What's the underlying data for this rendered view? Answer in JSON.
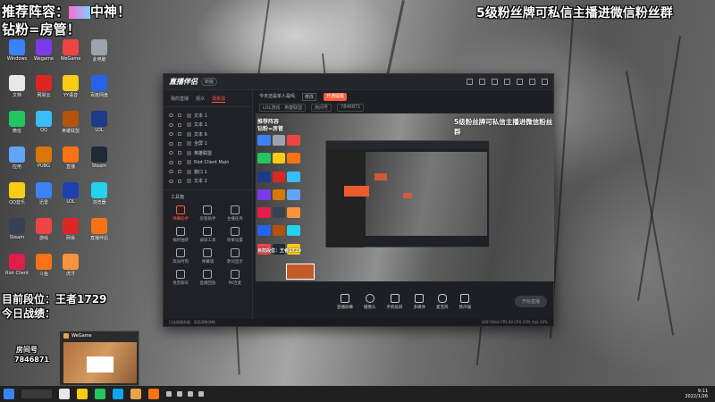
{
  "overlay": {
    "top_left_line1": "推荐阵容：",
    "top_left_line1_b": "中神！",
    "top_left_line2": "钻粉=房管！",
    "top_right": "5级粉丝牌可私信主播进微信粉丝群",
    "mid_left_line1": "目前段位：王者1729",
    "mid_left_line2": "今日战绩：",
    "room_label": "房间号",
    "room_id": "7846871"
  },
  "desktop_icons": [
    {
      "label": "Windows",
      "color": "#3b82f6"
    },
    {
      "label": "Wegame",
      "color": "#7c3aed"
    },
    {
      "label": "WeGame",
      "color": "#ef4444"
    },
    {
      "label": "此电脑",
      "color": "#9ca3af"
    },
    {
      "label": "文档",
      "color": "#e5e7eb"
    },
    {
      "label": "网易云",
      "color": "#dc2626"
    },
    {
      "label": "YY语音",
      "color": "#facc15"
    },
    {
      "label": "百度网盘",
      "color": "#2563eb"
    },
    {
      "label": "微信",
      "color": "#22c55e"
    },
    {
      "label": "QQ",
      "color": "#38bdf8"
    },
    {
      "label": "英雄联盟",
      "color": "#b45309"
    },
    {
      "label": "LOL",
      "color": "#1e3a8a"
    },
    {
      "label": "应用",
      "color": "#60a5fa"
    },
    {
      "label": "PUBG",
      "color": "#d97706"
    },
    {
      "label": "直播",
      "color": "#f97316"
    },
    {
      "label": "Steam",
      "color": "#1f2937"
    },
    {
      "label": "QQ音乐",
      "color": "#facc15"
    },
    {
      "label": "迅雷",
      "color": "#3b82f6"
    },
    {
      "label": "LOL",
      "color": "#1e40af"
    },
    {
      "label": "浏览器",
      "color": "#22d3ee"
    },
    {
      "label": "Steam",
      "color": "#374151"
    },
    {
      "label": "游戏",
      "color": "#ef4444"
    },
    {
      "label": "网易",
      "color": "#dc2626"
    },
    {
      "label": "直播伴侣",
      "color": "#f97316"
    },
    {
      "label": "Riot Client",
      "color": "#e11d48"
    },
    {
      "label": "斗鱼",
      "color": "#f97316"
    },
    {
      "label": "虎牙",
      "color": "#fb923c"
    }
  ],
  "app": {
    "logo": "直播伴侣",
    "version": "新版",
    "tabs": [
      "我的直播",
      "观众",
      "场景源"
    ],
    "sources": [
      "文本 1",
      "文本 1",
      "文本 6",
      "全屏 1",
      "英雄联盟",
      "Riot Client Main",
      "窗口 1",
      "文本 2"
    ],
    "tools_title": "工具箱",
    "tools": [
      "弹幕助手",
      "房管助手",
      "主播任务",
      "福利抽奖",
      "录屏工具",
      "效果设置",
      "高光时刻",
      "弹幕墙",
      "歌词显示",
      "语音聊天",
      "直播回放",
      "PK连麦"
    ],
    "info_title": "今天还是单人是吗",
    "info_tag": "修改",
    "info_badge": "开通提醒",
    "info_category": "LOL游戏 · 英雄联盟",
    "info_room_label": "房间号",
    "info_room": "7846871",
    "preview_text": "5级粉丝牌可私信主播进微信粉丝群",
    "preview_text_left": "推荐阵容\n钻粉=房管",
    "preview_text_left2": "目前段位：王者1729",
    "bottom_buttons": [
      "直播屏幕",
      "摄像头",
      "手机投屏",
      "多媒体",
      "麦克风",
      "扬声器"
    ],
    "start_button": "开始直播",
    "status_left": "已连接服务器 · 画面清晰流畅",
    "status_right": "码率 0kb/s  FPS 60  CPU 23%  内存 44%"
  },
  "taskbar": {
    "time": "9:11",
    "date": "2022/1/26"
  },
  "thumbnail": {
    "title": "WeGame"
  }
}
